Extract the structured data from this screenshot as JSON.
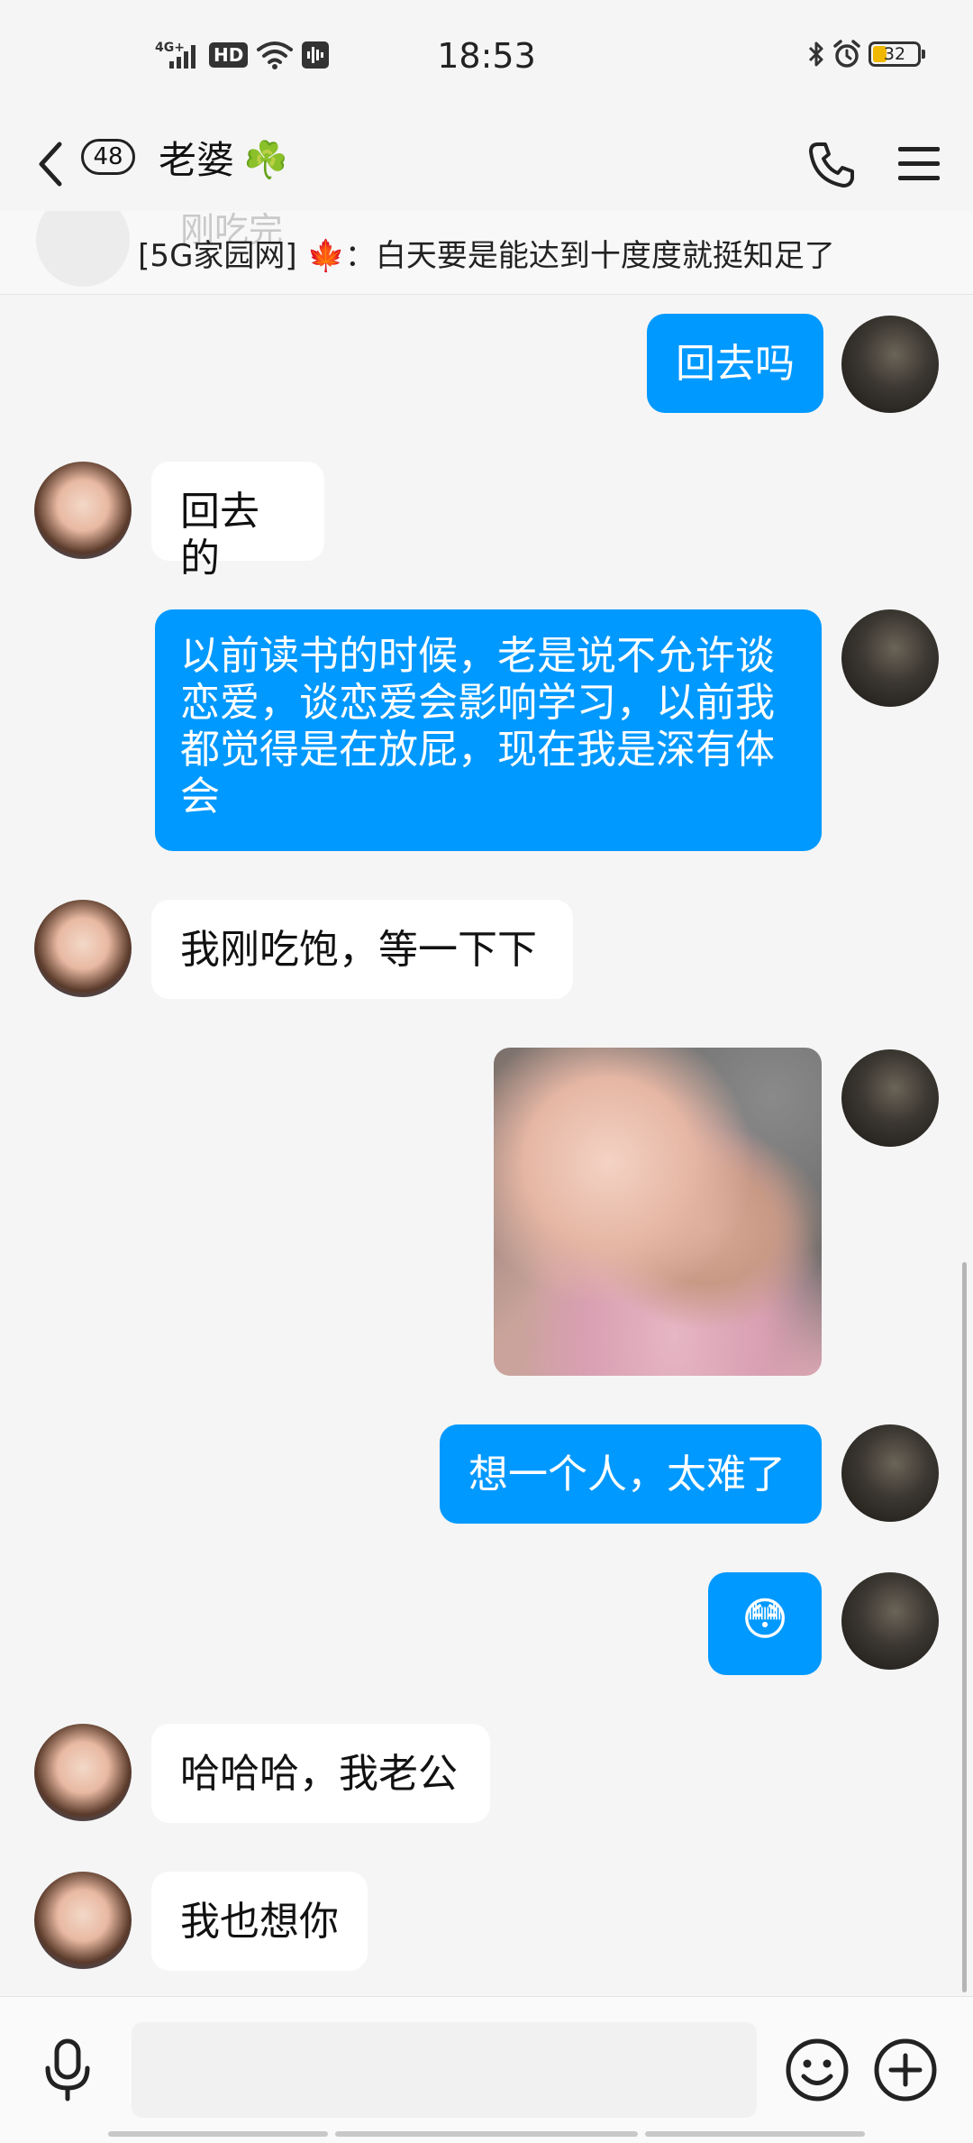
{
  "status_bar": {
    "network": "4G+",
    "hd": "HD",
    "time": "18:53",
    "battery": "32",
    "battery_level_percent": 32,
    "icons": [
      "signal-icon",
      "wifi-icon",
      "voice-icon",
      "bluetooth-icon",
      "alarm-icon",
      "battery-icon"
    ]
  },
  "header": {
    "unread_count": "48",
    "contact_name": "老婆",
    "name_emoji": "☘️"
  },
  "pinned": {
    "ghost_text": "刚吃完",
    "text": "[5G家园网] 🍁：白天要是能达到十度度就挺知足了"
  },
  "messages": [
    {
      "sender": "me",
      "type": "text",
      "text": "回去吗"
    },
    {
      "sender": "her",
      "type": "text",
      "text": "回去的"
    },
    {
      "sender": "me",
      "type": "text",
      "text": "以前读书的时候，老是说不允许谈恋爱，谈恋爱会影响学习，以前我都觉得是在放屁，现在我是深有体会"
    },
    {
      "sender": "her",
      "type": "text",
      "text": "我刚吃饱，等一下下"
    },
    {
      "sender": "me",
      "type": "image",
      "text": ""
    },
    {
      "sender": "me",
      "type": "text",
      "text": "想一个人，太难了"
    },
    {
      "sender": "me",
      "type": "emoji",
      "text": "😳"
    },
    {
      "sender": "her",
      "type": "text",
      "text": "哈哈哈，我老公"
    },
    {
      "sender": "her",
      "type": "text",
      "text": "我也想你"
    }
  ],
  "colors": {
    "outgoing_bubble": "#0099ff",
    "incoming_bubble": "#ffffff",
    "background": "#f5f5f5",
    "battery_fill": "#f0b800"
  },
  "input": {
    "value": "",
    "placeholder": ""
  }
}
